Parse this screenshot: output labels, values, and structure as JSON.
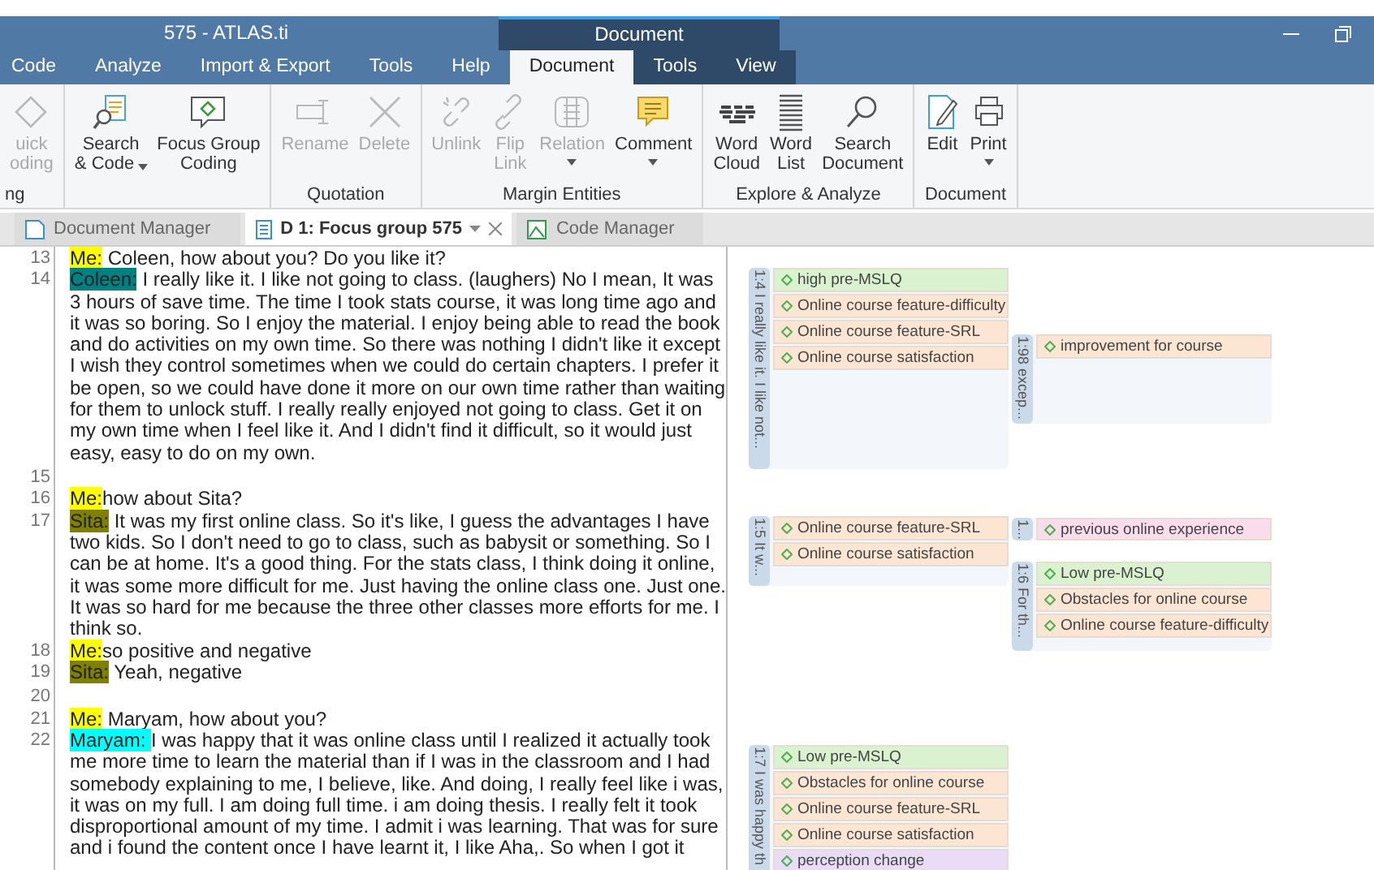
{
  "window": {
    "title": "575 - ATLAS.ti",
    "context_group": "Document"
  },
  "menu": [
    {
      "label": "Code",
      "selected": false
    },
    {
      "label": "Analyze",
      "selected": false
    },
    {
      "label": "Import & Export",
      "selected": false
    },
    {
      "label": "Tools",
      "selected": false
    },
    {
      "label": "Help",
      "selected": false
    },
    {
      "label": "Document",
      "selected": true
    },
    {
      "label": "Tools",
      "selected": false
    },
    {
      "label": "View",
      "selected": false
    }
  ],
  "ribbon": [
    {
      "label": "ng",
      "buttons": [
        {
          "kind": "quick",
          "lines": [
            "uick",
            "oding"
          ],
          "disabled": true,
          "dropdown": false
        }
      ]
    },
    {
      "buttons": [
        {
          "kind": "search-code",
          "lines": [
            "Search",
            "& Code"
          ],
          "disabled": false,
          "dropdown": true
        },
        {
          "kind": "focus",
          "lines": [
            "Focus Group",
            "Coding"
          ],
          "disabled": false,
          "dropdown": false
        }
      ]
    },
    {
      "label": "Quotation",
      "buttons": [
        {
          "kind": "rename",
          "lines": [
            "Rename"
          ],
          "disabled": true,
          "dropdown": false
        },
        {
          "kind": "delete",
          "lines": [
            "Delete"
          ],
          "disabled": true,
          "dropdown": false
        }
      ]
    },
    {
      "label": "Margin Entities",
      "buttons": [
        {
          "kind": "unlink",
          "lines": [
            "Unlink"
          ],
          "disabled": true,
          "dropdown": false
        },
        {
          "kind": "flip",
          "lines": [
            "Flip",
            "Link"
          ],
          "disabled": true,
          "dropdown": false
        },
        {
          "kind": "relation",
          "lines": [
            "Relation"
          ],
          "disabled": true,
          "dropdown": true
        },
        {
          "kind": "comment",
          "lines": [
            "Comment"
          ],
          "disabled": false,
          "dropdown": true
        }
      ]
    },
    {
      "label": "Explore & Analyze",
      "buttons": [
        {
          "kind": "cloud",
          "lines": [
            "Word",
            "Cloud"
          ],
          "disabled": false,
          "dropdown": false
        },
        {
          "kind": "list",
          "lines": [
            "Word",
            "List"
          ],
          "disabled": false,
          "dropdown": false
        },
        {
          "kind": "search",
          "lines": [
            "Search",
            "Document"
          ],
          "disabled": false,
          "dropdown": false
        }
      ]
    },
    {
      "label": "Document",
      "buttons": [
        {
          "kind": "edit",
          "lines": [
            "Edit"
          ],
          "disabled": false,
          "dropdown": false
        },
        {
          "kind": "print",
          "lines": [
            "Print"
          ],
          "disabled": false,
          "dropdown": true
        }
      ]
    }
  ],
  "doc_tabs": [
    {
      "kind": "manager",
      "label": "Document Manager",
      "selected": false
    },
    {
      "kind": "document",
      "label": "D 1: Focus group 575",
      "selected": true
    },
    {
      "kind": "codes",
      "label": "Code Manager",
      "selected": false
    }
  ],
  "document_lines": [
    {
      "number": "13",
      "speaker": "Me:",
      "color": "#ffff00",
      "text": " Coleen, how about you? Do you like it?"
    },
    {
      "number": "14",
      "speaker": "Coleen:",
      "color": "#008080",
      "text": " I really like it. I like not going to class. (laughers) No I mean, It was 3 hours of save time. The time I took stats course, it was long time ago and it was so boring. So I enjoy the material. I enjoy being able to read the book and do activities on my own time. So there was nothing I didn't like it except I wish they control sometimes when we could do certain chapters. I prefer it be open, so we could have done it more on our own time rather than waiting for them to unlock stuff. I really really enjoyed not going to class. Get it on my own time when I feel like it. And I didn't find it difficult, so it would just easy, easy to do on my own."
    },
    {
      "number": "15"
    },
    {
      "number": "16",
      "speaker": "Me:",
      "color": "#ffff00",
      "text": "how about Sita?"
    },
    {
      "number": "17",
      "speaker": "Sita:",
      "color": "#808000",
      "text": " It was my first online class. So it's like, I guess the advantages I have two kids. So I don't need to go to class, such as babysit or something. So I can be at home. It's a good thing.  For the stats class, I think doing it online, it was some more difficult for me. Just having the online class one. Just one. It was so hard for me because the three other classes more efforts for me. I think so."
    },
    {
      "number": "18",
      "speaker": "Me:",
      "color": "#ffff00",
      "text": "so positive and negative"
    },
    {
      "number": "19",
      "speaker": "Sita:",
      "color": "#808000",
      "text": " Yeah, negative"
    },
    {
      "number": "20"
    },
    {
      "number": "21",
      "speaker": "Me:",
      "color": "#ffff00",
      "text": " Maryam, how about you?"
    },
    {
      "number": "22",
      "speaker": "Maryam: ",
      "color": "#00ffff",
      "text": " I was happy that it was online class until I realized it actually took me more time to learn the material than if I was in the classroom and I had somebody explaining to me, I believe, like. And doing, I really feel like i was, it was on my full. I am doing full time. i am doing thesis. I really felt it took disproportional amount of my time. I admit i was learning. That was for sure and i found the content once I have learnt it, I like Aha,. So when I got it"
    }
  ],
  "quotations": [
    {
      "label": "1:4 I really like it. I like not...",
      "codes": [
        {
          "name": "high pre-MSLQ",
          "color": "#daf2cf"
        },
        {
          "name": "Online course feature-difficulty",
          "color": "#fde5d4"
        },
        {
          "name": "Online course feature-SRL",
          "color": "#fde5d4"
        },
        {
          "name": "Online course satisfaction",
          "color": "#fde5d4"
        }
      ]
    },
    {
      "label": "1:98 excep...",
      "codes": [
        {
          "name": "improvement for course",
          "color": "#fde5d4"
        }
      ]
    },
    {
      "label": "1:5 It w...",
      "codes": [
        {
          "name": "Online course feature-SRL",
          "color": "#fde5d4"
        },
        {
          "name": "Online course satisfaction",
          "color": "#fde5d4"
        }
      ]
    },
    {
      "label": "1...",
      "codes": [
        {
          "name": "previous online experience",
          "color": "#fbdcea"
        }
      ]
    },
    {
      "label": "1:6 For th...",
      "codes": [
        {
          "name": "Low pre-MSLQ",
          "color": "#daf2cf"
        },
        {
          "name": "Obstacles for online course",
          "color": "#fde5d4"
        },
        {
          "name": "Online course feature-difficulty",
          "color": "#fde5d4"
        }
      ]
    },
    {
      "label": "1:7 I was happy th",
      "codes": [
        {
          "name": "Low pre-MSLQ",
          "color": "#daf2cf"
        },
        {
          "name": "Obstacles for online course",
          "color": "#fde5d4"
        },
        {
          "name": "Online course feature-SRL",
          "color": "#fde5d4"
        },
        {
          "name": "Online course satisfaction",
          "color": "#fde5d4"
        },
        {
          "name": "perception change",
          "color": "#eadcf6"
        }
      ]
    }
  ]
}
